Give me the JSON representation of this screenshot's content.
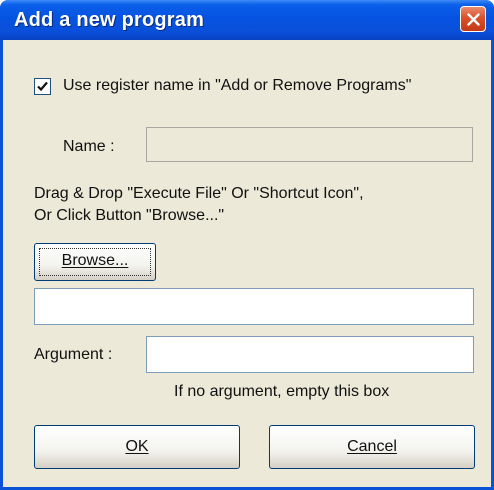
{
  "window": {
    "title": "Add a new program"
  },
  "register": {
    "checked": true,
    "label": "Use register name in  \"Add or Remove Programs\""
  },
  "name_field": {
    "label": "Name :",
    "value": ""
  },
  "instructions": {
    "line1": "Drag & Drop \"Execute File\" Or  \"Shortcut Icon\",",
    "line2": "Or Click Button \"Browse...\""
  },
  "browse_button": {
    "label": "Browse..."
  },
  "path_field": {
    "value": ""
  },
  "argument_field": {
    "label": "Argument :",
    "value": "",
    "hint": "If no argument, empty this box"
  },
  "buttons": {
    "ok": "OK",
    "cancel": "Cancel"
  },
  "colors": {
    "titlebar": "#0653e2",
    "dialog_bg": "#ece9d8",
    "close_button": "#d9502b"
  }
}
